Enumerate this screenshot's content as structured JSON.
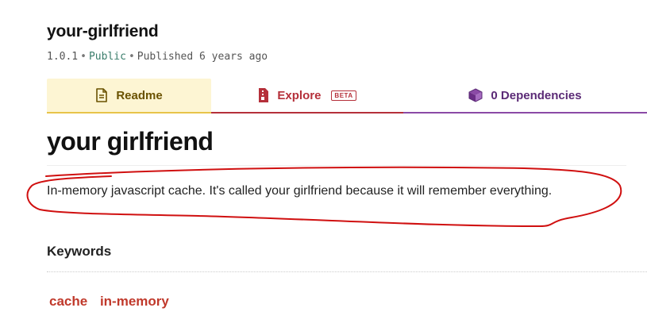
{
  "package": {
    "name": "your-girlfriend",
    "version": "1.0.1",
    "visibility": "Public",
    "published": "Published 6 years ago",
    "separator": "•"
  },
  "tabs": [
    {
      "label": "Readme",
      "icon": "file-text-icon",
      "active": true,
      "color": "#6a5200"
    },
    {
      "label": "Explore",
      "icon": "file-code-icon",
      "badge": "BETA",
      "color": "#b5303a"
    },
    {
      "label": "0 Dependencies",
      "icon": "cube-icon",
      "color": "#5b2a76"
    }
  ],
  "readme": {
    "title": "your girlfriend",
    "description": "In-memory javascript cache. It's called your girlfriend because it will remember everything."
  },
  "keywords": {
    "heading": "Keywords",
    "items": [
      "cache",
      "in-memory"
    ]
  },
  "colors": {
    "readme_tab_bg": "#fdf5d3",
    "readme_tab_border": "#e8c44a",
    "explore": "#b5303a",
    "dependencies": "#8b4aa6",
    "keyword": "#c0392b",
    "annotation": "#d01010"
  }
}
